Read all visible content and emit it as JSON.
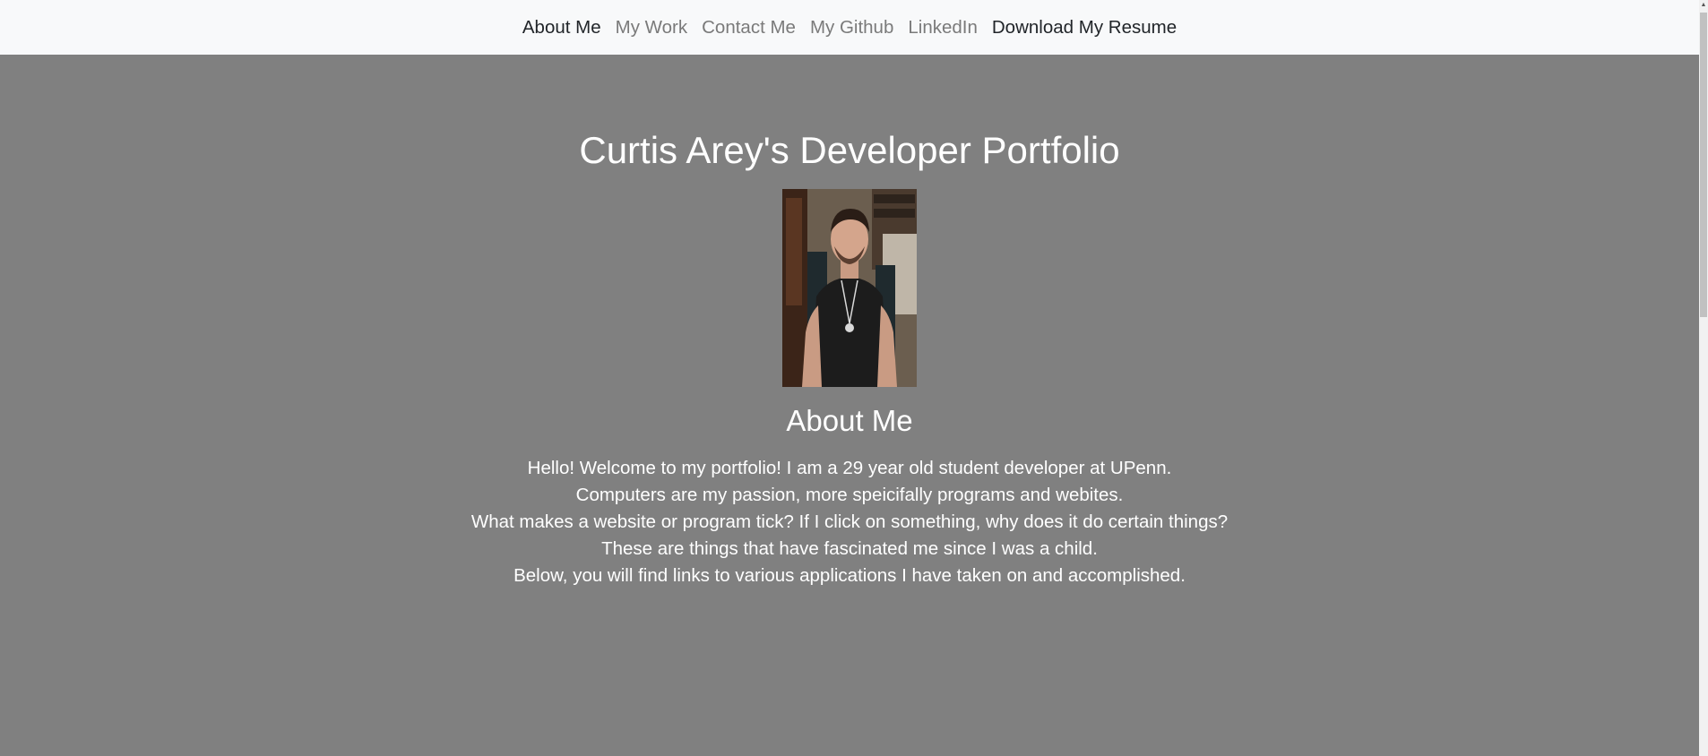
{
  "nav": {
    "items": [
      {
        "label": "About Me"
      },
      {
        "label": "My Work"
      },
      {
        "label": "Contact Me"
      },
      {
        "label": "My Github"
      },
      {
        "label": "LinkedIn"
      },
      {
        "label": "Download My Resume"
      }
    ]
  },
  "header": {
    "title": "Curtis Arey's Developer Portfolio"
  },
  "about": {
    "heading": "About Me",
    "lines": [
      "Hello! Welcome to my portfolio! I am a 29 year old student developer at UPenn.",
      "Computers are my passion, more speicifally programs and webites.",
      "What makes a website or program tick? If I click on something, why does it do certain things?",
      "These are things that have fascinated me since I was a child.",
      "Below, you will find links to various applications I have taken on and accomplished."
    ]
  },
  "colors": {
    "page_background": "#808080",
    "navbar_background": "#f8f9fa",
    "nav_active": "#212529",
    "nav_muted": "#7a7a7a",
    "text": "#ffffff"
  }
}
